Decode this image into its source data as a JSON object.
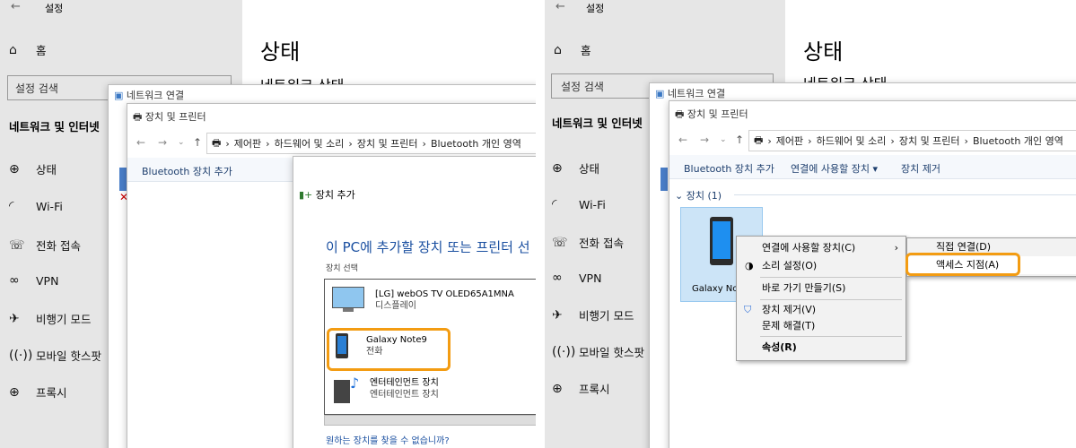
{
  "settings": {
    "app_title": "설정",
    "home": "홈",
    "search_placeholder": "설정 검색",
    "section": "네트워크 및 인터넷",
    "nav": [
      {
        "icon": "globe-status-icon",
        "label": "상태"
      },
      {
        "icon": "wifi-icon",
        "label": "Wi-Fi"
      },
      {
        "icon": "dialup-icon",
        "label": "전화 접속"
      },
      {
        "icon": "vpn-icon",
        "label": "VPN"
      },
      {
        "icon": "airplane-icon",
        "label": "비행기 모드"
      },
      {
        "icon": "hotspot-icon",
        "label": "모바일 핫스팟"
      },
      {
        "icon": "globe-icon",
        "label": "프록시"
      }
    ],
    "page_title": "상태",
    "subtitle": "네트워크 상태"
  },
  "network_window": {
    "title": "네트워크 연결"
  },
  "devices_window": {
    "title": "장치 및 프린터",
    "breadcrumb": [
      "제어판",
      "하드웨어 및 소리",
      "장치 및 프린터",
      "Bluetooth 개인 영역"
    ],
    "cmd_add": "Bluetooth 장치 추가",
    "cmd_connect": "연결에 사용할 장치 ▾",
    "cmd_remove": "장치 제거",
    "group_label": "장치 (1)",
    "device_label": "Galaxy Note9"
  },
  "add_device": {
    "title": "장치 추가",
    "heading": "이 PC에 추가할 장치 또는 프린터 선",
    "subhead": "장치 선택",
    "devices": [
      {
        "name": "[LG] webOS TV OLED65A1MNA",
        "type": "디스플레이"
      },
      {
        "name": "Galaxy Note9",
        "type": "전화"
      },
      {
        "name": "엔터테인먼트 장치",
        "type": "엔터테인먼트 장치"
      }
    ],
    "help_link": "원하는 장치를 찾을 수 없습니까?"
  },
  "context_menu": {
    "items": [
      {
        "label": "연결에 사용할 장치(C)",
        "submenu": true
      },
      {
        "label": "소리 설정(O)"
      },
      {
        "label": "바로 가기 만들기(S)"
      },
      {
        "label": "장치 제거(V)"
      },
      {
        "label": "문제 해결(T)"
      },
      {
        "label": "속성(R)"
      }
    ],
    "submenu": [
      {
        "label": "직접 연결(D)"
      },
      {
        "label": "액세스 지점(A)"
      }
    ]
  },
  "colors": {
    "highlight": "#f39c12",
    "accent_blue": "#1e6fd9",
    "sidebar_bg": "#e6e6e6"
  }
}
